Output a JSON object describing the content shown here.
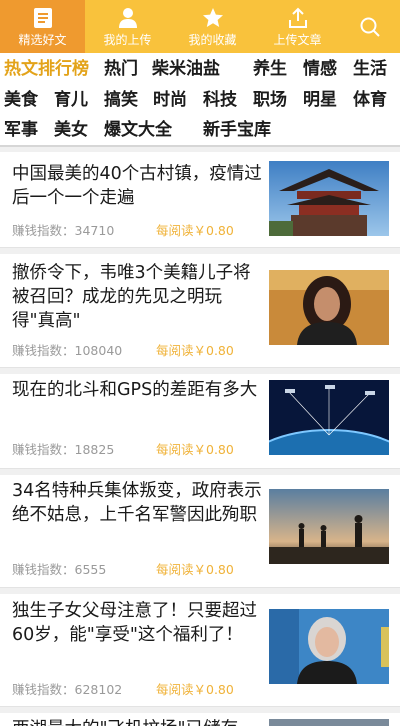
{
  "nav": {
    "tabs": [
      {
        "label": "精选好文",
        "icon": "document-icon"
      },
      {
        "label": "我的上传",
        "icon": "user-icon"
      },
      {
        "label": "我的收藏",
        "icon": "star-icon"
      },
      {
        "label": "上传文章",
        "icon": "upload-icon"
      },
      {
        "label": "",
        "icon": "search-icon"
      }
    ],
    "active_index": 0
  },
  "categories": [
    "热文排行榜",
    "热门",
    "柴米油盐",
    "养生",
    "情感",
    "生活",
    "美食",
    "育儿",
    "搞笑",
    "时尚",
    "科技",
    "职场",
    "明星",
    "体育",
    "军事",
    "美女",
    "爆文大全",
    "新手宝库"
  ],
  "meta_label": "赚钱指数：",
  "price_label": "每阅读￥0.80",
  "articles": [
    {
      "title": "中国最美的40个古村镇，疫情过后一个一个走遍",
      "index": "34710",
      "image": "pagoda-photo"
    },
    {
      "title": "撤侨令下，韦唯3个美籍儿子将被召回？成龙的先见之明玩得\"真高\"",
      "index": "108040",
      "image": "woman-portrait-photo"
    },
    {
      "title": "现在的北斗和GPS的差距有多大",
      "index": "18825",
      "image": "satellite-earth-photo"
    },
    {
      "title": "34名特种兵集体叛变，政府表示绝不姑息，上千名军警因此殉职",
      "index": "6555",
      "image": "soldiers-sunset-photo"
    },
    {
      "title": "独生子女父母注意了！只要超过60岁，能\"享受\"这个福利了！",
      "index": "628102",
      "image": "elderly-woman-speech-photo"
    },
    {
      "title": "西湖最大的\"飞机坟场\"已储存",
      "index": "",
      "image": "partial-photo"
    }
  ]
}
